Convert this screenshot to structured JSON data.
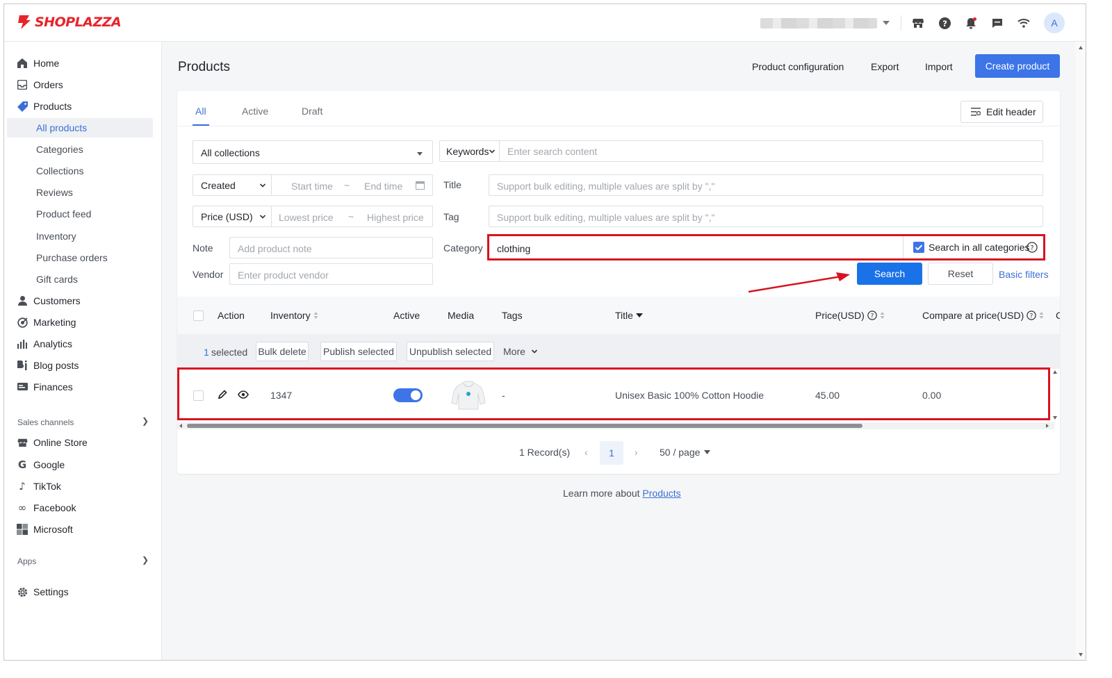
{
  "brand": {
    "name": "SHOPLAZZA",
    "color": "#e8232b"
  },
  "colors": {
    "accent": "#3b6fd8",
    "primary_button": "#3d74e8",
    "search_button": "#1a72e8",
    "highlight": "#d8131f"
  },
  "topbar": {
    "icons": [
      "store-icon",
      "help-icon",
      "bell-icon",
      "chat-icon",
      "wifi-icon"
    ],
    "avatar_letter": "A"
  },
  "sidebar": {
    "items": [
      {
        "label": "Home",
        "icon": "home-icon"
      },
      {
        "label": "Orders",
        "icon": "orders-icon"
      },
      {
        "label": "Products",
        "icon": "tag-icon"
      }
    ],
    "product_sub": [
      "All products",
      "Categories",
      "Collections",
      "Reviews",
      "Product feed",
      "Inventory",
      "Purchase orders",
      "Gift cards"
    ],
    "items_after": [
      {
        "label": "Customers",
        "icon": "person-icon"
      },
      {
        "label": "Marketing",
        "icon": "marketing-icon"
      },
      {
        "label": "Analytics",
        "icon": "analytics-icon"
      },
      {
        "label": "Blog posts",
        "icon": "blog-icon"
      },
      {
        "label": "Finances",
        "icon": "finance-icon"
      }
    ],
    "sales_channels_label": "Sales channels",
    "channels": [
      {
        "label": "Online Store",
        "icon": "store-icon"
      },
      {
        "label": "Google",
        "icon": "google-icon"
      },
      {
        "label": "TikTok",
        "icon": "tiktok-icon"
      },
      {
        "label": "Facebook",
        "icon": "meta-icon"
      },
      {
        "label": "Microsoft",
        "icon": "microsoft-icon"
      }
    ],
    "apps_label": "Apps",
    "settings_label": "Settings"
  },
  "header": {
    "title": "Products",
    "links": [
      "Product configuration",
      "Export",
      "Import"
    ],
    "create_label": "Create product"
  },
  "tabs": [
    "All",
    "Active",
    "Draft"
  ],
  "edit_header_label": "Edit header",
  "filters": {
    "collection_value": "All collections",
    "keywords_label": "Keywords",
    "search_placeholder": "Enter search content",
    "date_type": "Created",
    "start_placeholder": "Start time",
    "end_placeholder": "End time",
    "range_sep": "~",
    "price_type": "Price (USD)",
    "lowest_placeholder": "Lowest price",
    "highest_placeholder": "Highest price",
    "title_label": "Title",
    "title_placeholder": "Support bulk editing, multiple values are split by \",\"",
    "tag_label": "Tag",
    "tag_placeholder": "Support bulk editing, multiple values are split by \",\"",
    "note_label": "Note",
    "note_placeholder": "Add product note",
    "category_label": "Category",
    "category_value": "clothing",
    "search_all_label": "Search in all categories",
    "search_all_checked": true,
    "vendor_label": "Vendor",
    "vendor_placeholder": "Enter product vendor",
    "search_label": "Search",
    "reset_label": "Reset",
    "basic_filters_label": "Basic filters"
  },
  "table": {
    "columns": [
      "Action",
      "Inventory",
      "Active",
      "Media",
      "Tags",
      "Title",
      "Price(USD)",
      "Compare at price(USD)",
      "C"
    ],
    "bulk": {
      "count": "1",
      "selected_label": "selected",
      "bulk_delete": "Bulk delete",
      "publish": "Publish selected",
      "unpublish": "Unpublish selected",
      "more": "More"
    },
    "rows": [
      {
        "inventory": "1347",
        "active": true,
        "tags": "-",
        "title": "Unisex Basic 100% Cotton Hoodie",
        "price": "45.00",
        "compare_price": "0.00"
      }
    ]
  },
  "pagination": {
    "records": "1 Record(s)",
    "current_page": "1",
    "per_page": "50 / page"
  },
  "footer": {
    "text": "Learn more about",
    "link": "Products"
  }
}
